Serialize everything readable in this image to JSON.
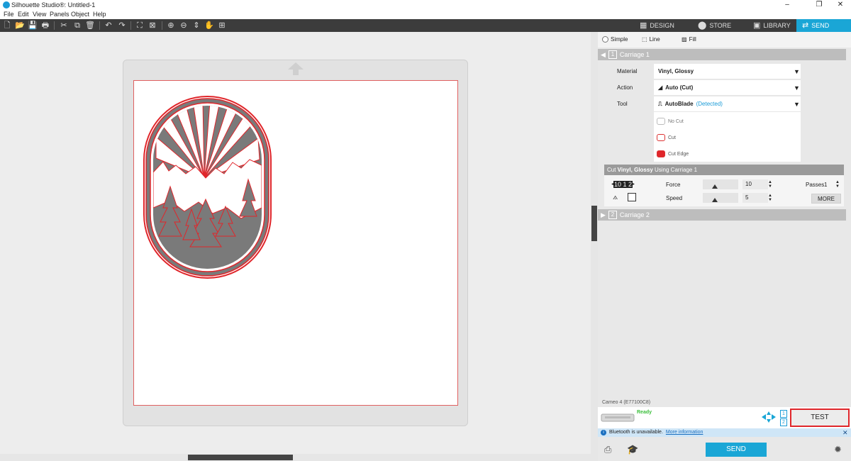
{
  "window": {
    "title": "Silhouette Studio®: Untitled-1",
    "minimize": "–",
    "maximize": "❐",
    "close": "✕"
  },
  "menu": [
    "File",
    "Edit",
    "View",
    "Panels",
    "Object",
    "Help"
  ],
  "tabs": [
    {
      "label": "DESIGN",
      "icon": "grid-icon"
    },
    {
      "label": "STORE",
      "icon": "store-icon"
    },
    {
      "label": "LIBRARY",
      "icon": "library-icon"
    },
    {
      "label": "SEND",
      "icon": "send-icon",
      "active": true
    }
  ],
  "modes": {
    "simple": "Simple",
    "line": "Line",
    "fill": "Fill"
  },
  "carriage1": {
    "num": "1",
    "label": "Carriage 1"
  },
  "carriage2": {
    "num": "2",
    "label": "Carriage 2"
  },
  "settings": {
    "material_label": "Material",
    "material_value": "Vinyl, Glossy",
    "action_label": "Action",
    "action_value": "Auto (Cut)",
    "tool_label": "Tool",
    "tool_value": "AutoBlade",
    "tool_detected": "(Detected)",
    "options": [
      "No Cut",
      "Cut",
      "Cut Edge"
    ]
  },
  "cut_bar": {
    "prefix": "Cut ",
    "material": "Vinyl, Glossy",
    "suffix": " Using Carriage 1"
  },
  "blade": "10 1 2",
  "force": {
    "label": "Force",
    "value": "10",
    "level": 0.18
  },
  "speed": {
    "label": "Speed",
    "value": "5",
    "level": 0.18
  },
  "passes": {
    "label": "Passes",
    "value": "1"
  },
  "more_label": "MORE",
  "device": {
    "name": "Cameo 4 (E77100C8)",
    "status": "Ready",
    "carriage_nums": [
      "1",
      "2"
    ]
  },
  "test_label": "TEST",
  "bluetooth": {
    "message": "Bluetooth is unavailable.",
    "link": "More information",
    "close": "✕"
  },
  "send_label": "SEND",
  "colors": {
    "accent": "#1aa6d6",
    "cut_red": "#e0262b",
    "fill_gray": "#7a7a7a"
  }
}
